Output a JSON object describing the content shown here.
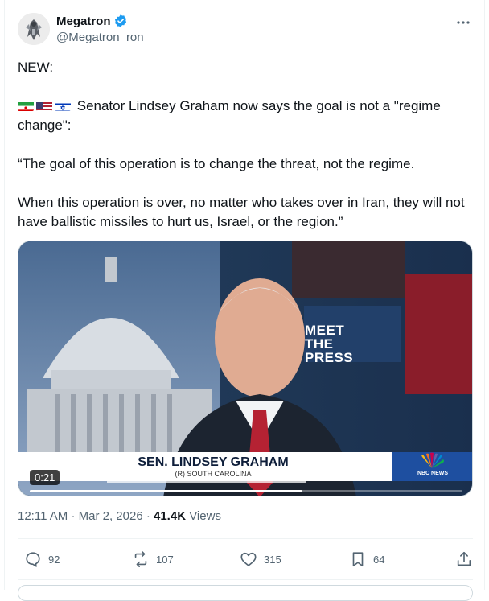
{
  "author": {
    "name": "Megatron",
    "handle": "@Megatron_ron",
    "verified": true,
    "verified_color": "#1d9bf0"
  },
  "post": {
    "line1": "NEW:",
    "flags": [
      "iran-flag-icon",
      "us-flag-icon",
      "israel-flag-icon"
    ],
    "line2": "Senator Lindsey Graham now says the goal is not a \"regime change\":",
    "quote1": "“The goal of this operation is to change the threat, not the regime.",
    "quote2": "When this operation is over, no matter who takes over in Iran, they will not have ballistic missiles to hurt us, Israel, or the region.”"
  },
  "video": {
    "duration": "0:21",
    "lower_third_name": "SEN. LINDSEY GRAHAM",
    "lower_third_sub": "(R) SOUTH CAROLINA",
    "show_logo": "MEET THE PRESS",
    "network": "NBC NEWS",
    "progress": 0.63
  },
  "meta": {
    "time": "12:11 AM",
    "date": "Mar 2, 2026",
    "views_count": "41.4K",
    "views_label": "Views"
  },
  "actions": {
    "replies": "92",
    "reposts": "107",
    "likes": "315",
    "bookmarks": "64"
  }
}
